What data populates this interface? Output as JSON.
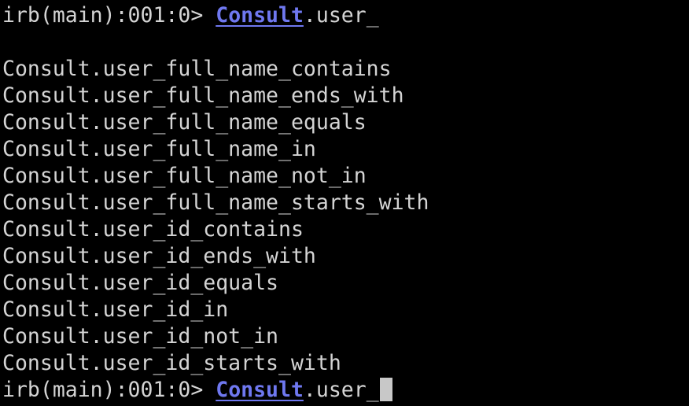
{
  "prompt": {
    "text": "irb(main):001:0> ",
    "constant": "Consult",
    "input": ".user_"
  },
  "completions": [
    "Consult.user_full_name_contains",
    "Consult.user_full_name_ends_with",
    "Consult.user_full_name_equals",
    "Consult.user_full_name_in",
    "Consult.user_full_name_not_in",
    "Consult.user_full_name_starts_with",
    "Consult.user_id_contains",
    "Consult.user_id_ends_with",
    "Consult.user_id_equals",
    "Consult.user_id_in",
    "Consult.user_id_not_in",
    "Consult.user_id_starts_with"
  ],
  "colors": {
    "background": "#000000",
    "text": "#d4d4d4",
    "constant": "#6f78f0",
    "cursor": "#c8c8c8"
  }
}
